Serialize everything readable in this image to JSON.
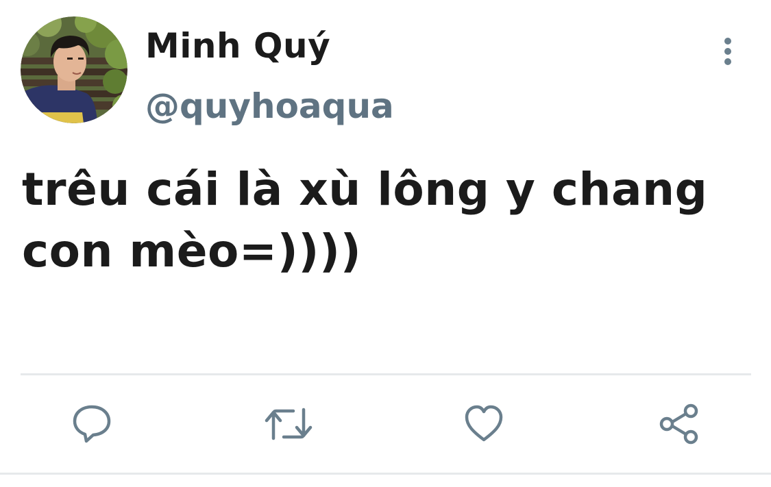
{
  "author": {
    "display_name": "Minh Quý",
    "handle": "@quyhoaqua",
    "avatar_icon": "profile-photo"
  },
  "tweet": {
    "text": "trêu cái là xù lông y chang con mèo=))))"
  },
  "actions": [
    {
      "name": "reply",
      "icon": "speech-bubble-icon"
    },
    {
      "name": "retweet",
      "icon": "retweet-arrows-icon"
    },
    {
      "name": "like",
      "icon": "heart-icon"
    },
    {
      "name": "share",
      "icon": "share-nodes-icon"
    }
  ],
  "colors": {
    "text": "#1b1b1b",
    "handle": "#5f7382",
    "icon": "#6a7f8d",
    "divider": "#e6e9eb"
  }
}
